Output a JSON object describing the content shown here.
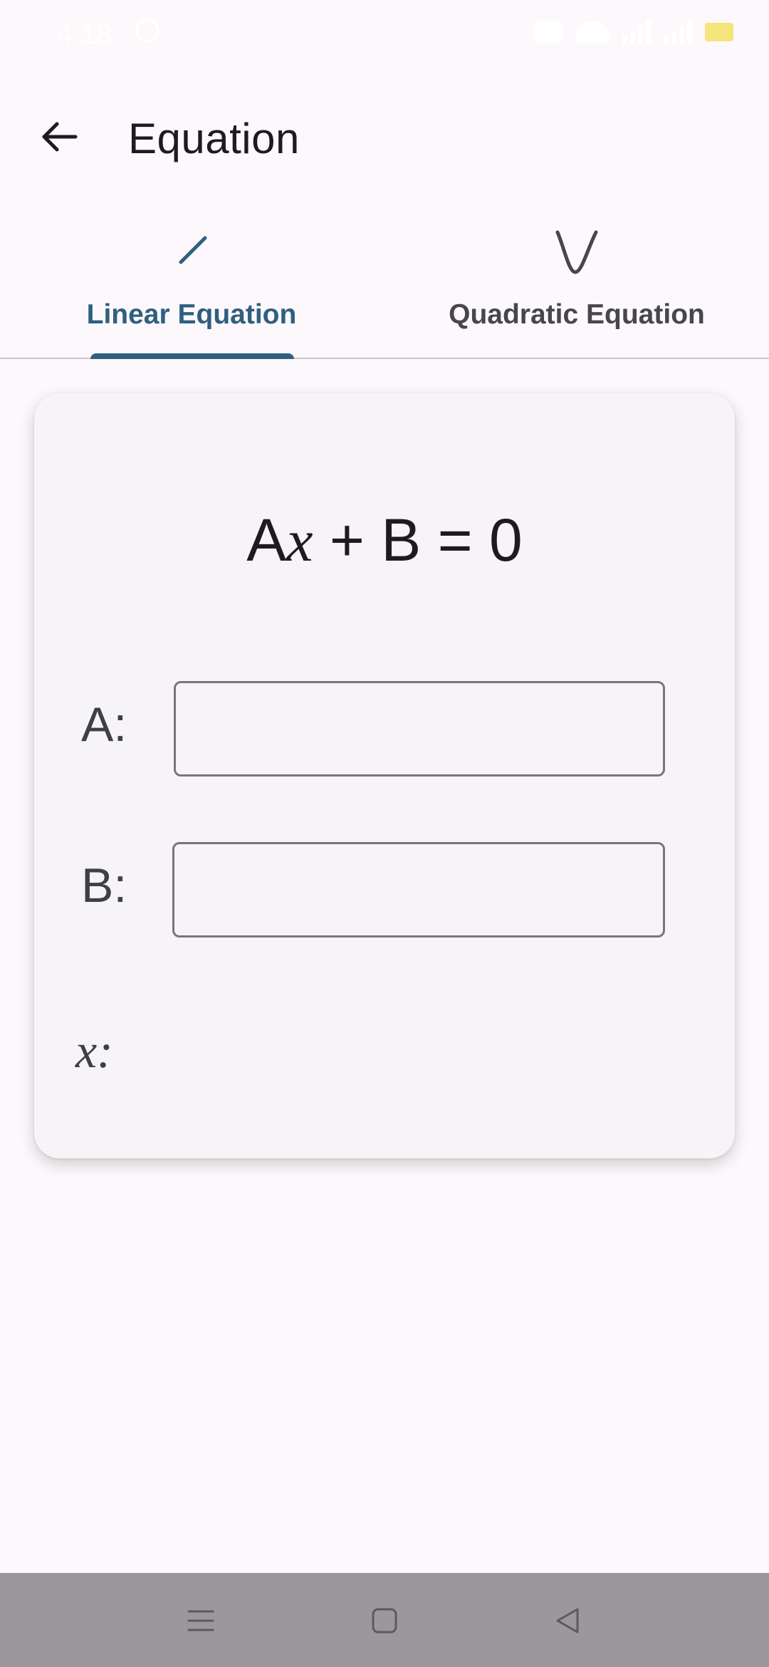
{
  "status_bar": {
    "time": "4:18"
  },
  "app_bar": {
    "title": "Equation",
    "back_icon": "arrow-left-icon"
  },
  "tabs": [
    {
      "label": "Linear Equation",
      "icon": "linear-line-icon",
      "selected": true
    },
    {
      "label": "Quadratic Equation",
      "icon": "parabola-icon",
      "selected": false
    }
  ],
  "card": {
    "formula": {
      "coef_a": "A",
      "variable": "x",
      "rest": " + B = 0"
    },
    "fields": {
      "a_label": "A:",
      "a_value": "",
      "b_label": "B:",
      "b_value": ""
    },
    "result": {
      "label": "x:",
      "value": ""
    }
  },
  "nav_bar": {
    "icons": [
      "menu-icon",
      "home-square-icon",
      "back-triangle-icon"
    ]
  },
  "colors": {
    "accent": "#2f5f80",
    "background": "#fdf8fb",
    "card": "#f7f4f8",
    "nav_bar": "#9b979b"
  }
}
